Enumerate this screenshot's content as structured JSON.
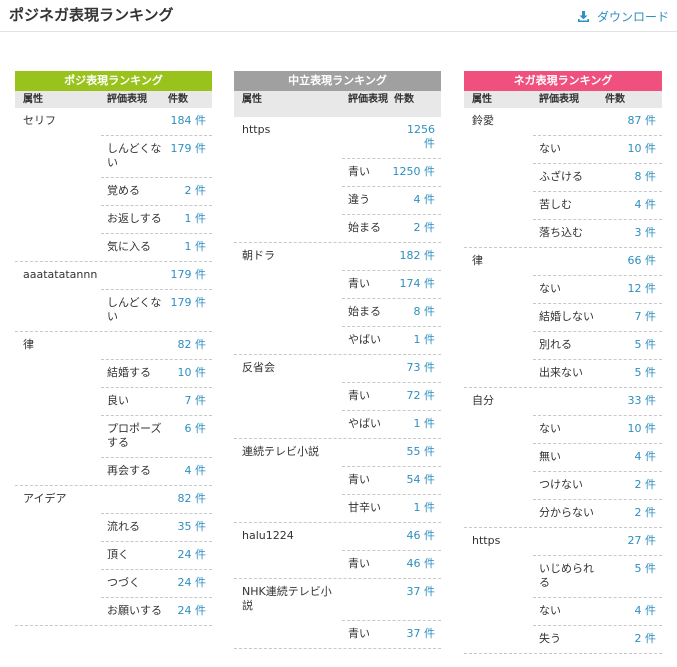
{
  "header": {
    "title": "ポジネガ表現ランキング",
    "download_label": "ダウンロード",
    "download_color": "#2e8fc0"
  },
  "columns": [
    {
      "key": "pos",
      "title": "ポジ表現ランキング",
      "color": "#99c31c",
      "headers": {
        "attr": "属性",
        "expr": "評価表現",
        "count": "件数"
      },
      "groups": [
        {
          "attr": "セリフ",
          "count": "184 件",
          "items": [
            {
              "expr": "しんどくない",
              "count": "179 件"
            },
            {
              "expr": "覚める",
              "count": "2 件"
            },
            {
              "expr": "お返しする",
              "count": "1 件"
            },
            {
              "expr": "気に入る",
              "count": "1 件"
            }
          ]
        },
        {
          "attr": "aaatatatannn",
          "count": "179 件",
          "items": [
            {
              "expr": "しんどくない",
              "count": "179 件"
            }
          ]
        },
        {
          "attr": "律",
          "count": "82 件",
          "items": [
            {
              "expr": "結婚する",
              "count": "10 件"
            },
            {
              "expr": "良い",
              "count": "7 件"
            },
            {
              "expr": "プロポーズする",
              "count": "6 件"
            },
            {
              "expr": "再会する",
              "count": "4 件"
            }
          ]
        },
        {
          "attr": "アイデア",
          "count": "82 件",
          "items": [
            {
              "expr": "流れる",
              "count": "35 件"
            },
            {
              "expr": "頂く",
              "count": "24 件"
            },
            {
              "expr": "つづく",
              "count": "24 件"
            },
            {
              "expr": "お願いする",
              "count": "24 件"
            }
          ]
        }
      ]
    },
    {
      "key": "neu",
      "title": "中立表現ランキング",
      "color": "#a0a0a0",
      "headers": {
        "attr": "属性",
        "expr": "評価表現",
        "count": "件数"
      },
      "groups": [
        {
          "attr": "https",
          "count": "1256 件",
          "items": [
            {
              "expr": "青い",
              "count": "1250 件"
            },
            {
              "expr": "違う",
              "count": "4 件"
            },
            {
              "expr": "始まる",
              "count": "2 件"
            }
          ]
        },
        {
          "attr": "朝ドラ",
          "count": "182 件",
          "items": [
            {
              "expr": "青い",
              "count": "174 件"
            },
            {
              "expr": "始まる",
              "count": "8 件"
            },
            {
              "expr": "やばい",
              "count": "1 件"
            }
          ]
        },
        {
          "attr": "反省会",
          "count": "73 件",
          "items": [
            {
              "expr": "青い",
              "count": "72 件"
            },
            {
              "expr": "やばい",
              "count": "1 件"
            }
          ]
        },
        {
          "attr": "連続テレビ小説",
          "count": "55 件",
          "items": [
            {
              "expr": "青い",
              "count": "54 件"
            },
            {
              "expr": "甘辛い",
              "count": "1 件"
            }
          ]
        },
        {
          "attr": "halu1224",
          "count": "46 件",
          "items": [
            {
              "expr": "青い",
              "count": "46 件"
            }
          ]
        },
        {
          "attr": "NHK連続テレビ小説",
          "count": "37 件",
          "items": [
            {
              "expr": "青い",
              "count": "37 件"
            }
          ]
        }
      ]
    },
    {
      "key": "neg",
      "title": "ネガ表現ランキング",
      "color": "#f0507e",
      "headers": {
        "attr": "属性",
        "expr": "評価表現",
        "count": "件数"
      },
      "groups": [
        {
          "attr": "鈴愛",
          "count": "87 件",
          "items": [
            {
              "expr": "ない",
              "count": "10 件"
            },
            {
              "expr": "ふざける",
              "count": "8 件"
            },
            {
              "expr": "苦しむ",
              "count": "4 件"
            },
            {
              "expr": "落ち込む",
              "count": "3 件"
            }
          ]
        },
        {
          "attr": "律",
          "count": "66 件",
          "items": [
            {
              "expr": "ない",
              "count": "12 件"
            },
            {
              "expr": "結婚しない",
              "count": "7 件"
            },
            {
              "expr": "別れる",
              "count": "5 件"
            },
            {
              "expr": "出来ない",
              "count": "5 件"
            }
          ]
        },
        {
          "attr": "自分",
          "count": "33 件",
          "items": [
            {
              "expr": "ない",
              "count": "10 件"
            },
            {
              "expr": "無い",
              "count": "4 件"
            },
            {
              "expr": "つけない",
              "count": "2 件"
            },
            {
              "expr": "分からない",
              "count": "2 件"
            }
          ]
        },
        {
          "attr": "https",
          "count": "27 件",
          "items": [
            {
              "expr": "いじめられる",
              "count": "5 件"
            },
            {
              "expr": "ない",
              "count": "4 件"
            },
            {
              "expr": "失う",
              "count": "2 件"
            }
          ]
        }
      ]
    }
  ]
}
